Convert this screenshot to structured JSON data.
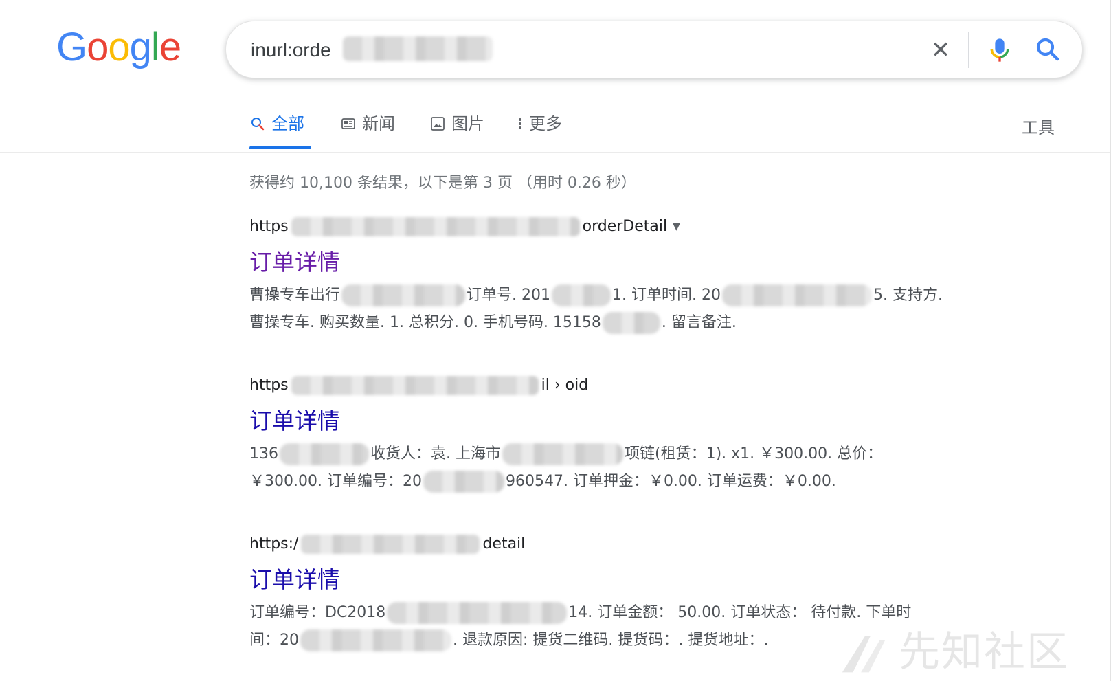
{
  "logo": {
    "letters": [
      "G",
      "o",
      "o",
      "g",
      "l",
      "e"
    ],
    "colors": [
      "#4285F4",
      "#EA4335",
      "#FBBC05",
      "#4285F4",
      "#34A853",
      "#EA4335"
    ]
  },
  "search": {
    "query_visible": "inurl:orde",
    "clear_icon": "close-icon",
    "mic_icon": "mic-icon",
    "search_icon": "search-icon"
  },
  "tabs": [
    {
      "label": "全部",
      "icon": "search-icon",
      "active": true
    },
    {
      "label": "新闻",
      "icon": "news-icon"
    },
    {
      "label": "图片",
      "icon": "image-icon"
    },
    {
      "label": "更多",
      "icon": "more-vert-icon"
    }
  ],
  "tools_label": "工具",
  "stats": "获得约 10,100 条结果，以下是第 3 页 （用时 0.26 秒）",
  "results": [
    {
      "url_prefix": "https",
      "url_suffix": "orderDetail",
      "title": "订单详情",
      "snippet_line1": [
        "曹操专车出行",
        "订单号. 201",
        "1. 订单时间. 20",
        "5. 支持方."
      ],
      "snippet_line2": [
        "曹操专车. 购买数量. 1. 总积分. 0. 手机号码. 15158",
        ". 留言备注."
      ]
    },
    {
      "url_prefix": "https",
      "url_suffix": "il › oid",
      "title": "订单详情",
      "snippet_line1": [
        "136",
        "收货人：袁. 上海市",
        "项链(租赁：1). x1. ￥300.00. 总价："
      ],
      "snippet_line2": [
        "￥300.00. 订单编号：20",
        "960547. 订单押金：￥0.00. 订单运费：￥0.00."
      ]
    },
    {
      "url_prefix": "https:/",
      "url_suffix": "detail",
      "title": "订单详情",
      "snippet_line1": [
        "订单编号：DC2018",
        "14. 订单金额： 50.00. 订单状态： 待付款. 下单时"
      ],
      "snippet_line2": [
        "间：20",
        ". 退款原因: 提货二维码. 提货码：. 提货地址：."
      ]
    }
  ],
  "watermark": "先知社区",
  "colors": {
    "link": "#1a0dab",
    "visited": "#681da8",
    "accent": "#1a73e8"
  }
}
